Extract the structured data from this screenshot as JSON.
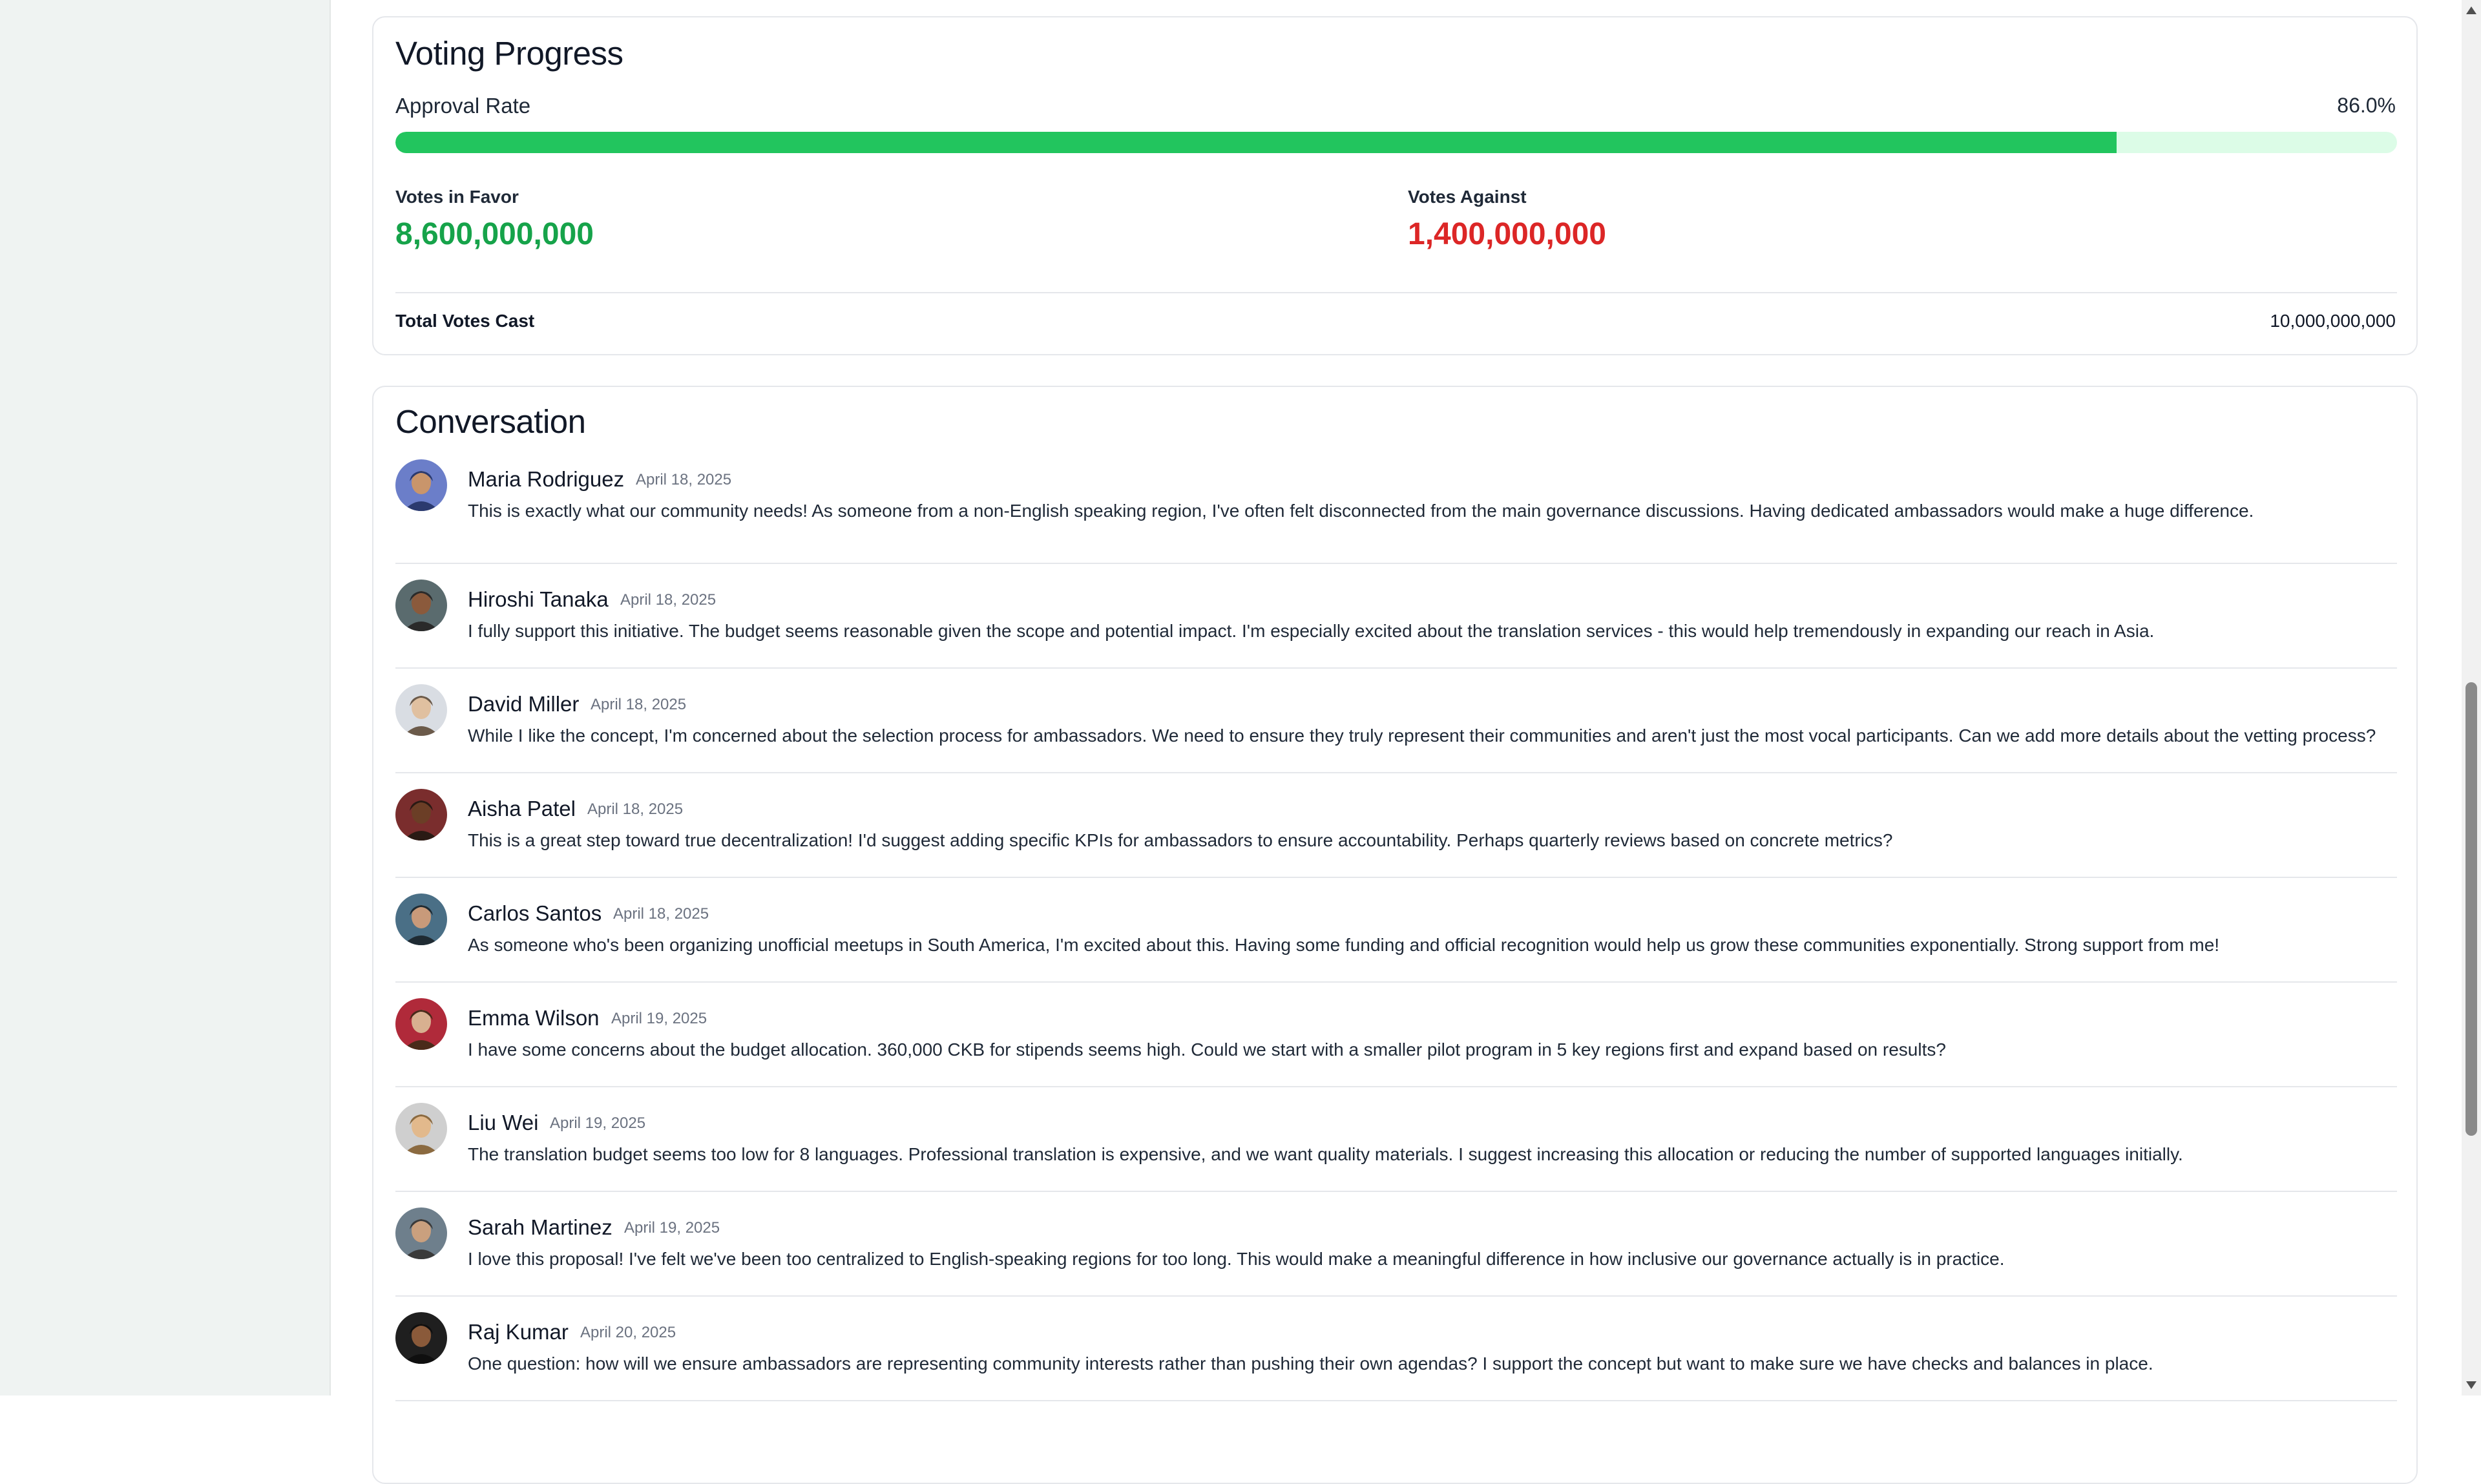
{
  "voting": {
    "title": "Voting Progress",
    "approval_label": "Approval Rate",
    "approval_value": "86.0%",
    "approval_fraction": 0.86,
    "favor_label": "Votes in Favor",
    "favor_value": "8,600,000,000",
    "against_label": "Votes Against",
    "against_value": "1,400,000,000",
    "total_label": "Total Votes Cast",
    "total_value": "10,000,000,000",
    "colors": {
      "favor": "#16a34a",
      "against": "#dc2626",
      "progress": "#22c55e",
      "track": "#dcfce7"
    }
  },
  "conversation": {
    "title": "Conversation",
    "comments": [
      {
        "name": "Maria Rodriguez",
        "date": "April 18, 2025",
        "text": "This is exactly what our community needs! As someone from a non-English speaking region, I've often felt disconnected from the main governance discussions. Having dedicated ambassadors would make a huge difference."
      },
      {
        "name": "Hiroshi Tanaka",
        "date": "April 18, 2025",
        "text": "I fully support this initiative. The budget seems reasonable given the scope and potential impact. I'm especially excited about the translation services - this would help tremendously in expanding our reach in Asia."
      },
      {
        "name": "David Miller",
        "date": "April 18, 2025",
        "text": "While I like the concept, I'm concerned about the selection process for ambassadors. We need to ensure they truly represent their communities and aren't just the most vocal participants. Can we add more details about the vetting process?"
      },
      {
        "name": "Aisha Patel",
        "date": "April 18, 2025",
        "text": "This is a great step toward true decentralization! I'd suggest adding specific KPIs for ambassadors to ensure accountability. Perhaps quarterly reviews based on concrete metrics?"
      },
      {
        "name": "Carlos Santos",
        "date": "April 18, 2025",
        "text": "As someone who's been organizing unofficial meetups in South America, I'm excited about this. Having some funding and official recognition would help us grow these communities exponentially. Strong support from me!"
      },
      {
        "name": "Emma Wilson",
        "date": "April 19, 2025",
        "text": "I have some concerns about the budget allocation. 360,000 CKB for stipends seems high. Could we start with a smaller pilot program in 5 key regions first and expand based on results?"
      },
      {
        "name": "Liu Wei",
        "date": "April 19, 2025",
        "text": "The translation budget seems too low for 8 languages. Professional translation is expensive, and we want quality materials. I suggest increasing this allocation or reducing the number of supported languages initially."
      },
      {
        "name": "Sarah Martinez",
        "date": "April 19, 2025",
        "text": "I love this proposal! I've felt we've been too centralized to English-speaking regions for too long. This would make a meaningful difference in how inclusive our governance actually is in practice."
      },
      {
        "name": "Raj Kumar",
        "date": "April 20, 2025",
        "text": "One question: how will we ensure ambassadors are representing community interests rather than pushing their own agendas? I support the concept but want to make sure we have checks and balances in place."
      }
    ]
  }
}
